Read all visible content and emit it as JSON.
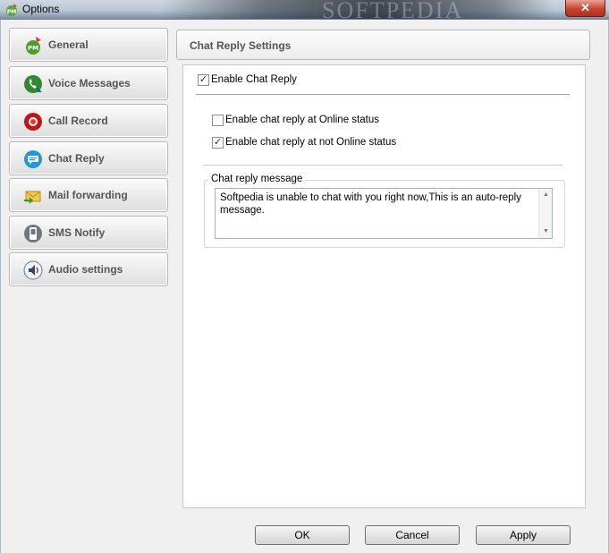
{
  "window": {
    "title": "Options",
    "watermark": "SOFTPEDIA",
    "close_label": "✕"
  },
  "sidebar": {
    "items": [
      {
        "label": "General",
        "icon": "general-pm-icon"
      },
      {
        "label": "Voice Messages",
        "icon": "phone-icon"
      },
      {
        "label": "Call Record",
        "icon": "record-icon"
      },
      {
        "label": "Chat Reply",
        "icon": "chat-bubble-icon"
      },
      {
        "label": "Mail forwarding",
        "icon": "mail-icon"
      },
      {
        "label": "SMS Notify",
        "icon": "sms-icon"
      },
      {
        "label": "Audio settings",
        "icon": "speaker-icon"
      }
    ]
  },
  "section": {
    "title": "Chat Reply Settings"
  },
  "settings": {
    "enable_chat_reply": {
      "label": "Enable Chat Reply",
      "checked": true
    },
    "online_status": {
      "label": "Enable chat reply at Online status",
      "checked": false
    },
    "not_online_status": {
      "label": "Enable chat reply at not Online status",
      "checked": true
    },
    "message_group_label": "Chat reply message",
    "message_value": "Softpedia is unable to chat with you right now,This is an auto-reply message."
  },
  "buttons": {
    "ok": "OK",
    "cancel": "Cancel",
    "apply": "Apply"
  },
  "colors": {
    "window_frame": "#b9c6d4",
    "client_bg": "#f0f0f0",
    "close_red": "#c7442e"
  }
}
